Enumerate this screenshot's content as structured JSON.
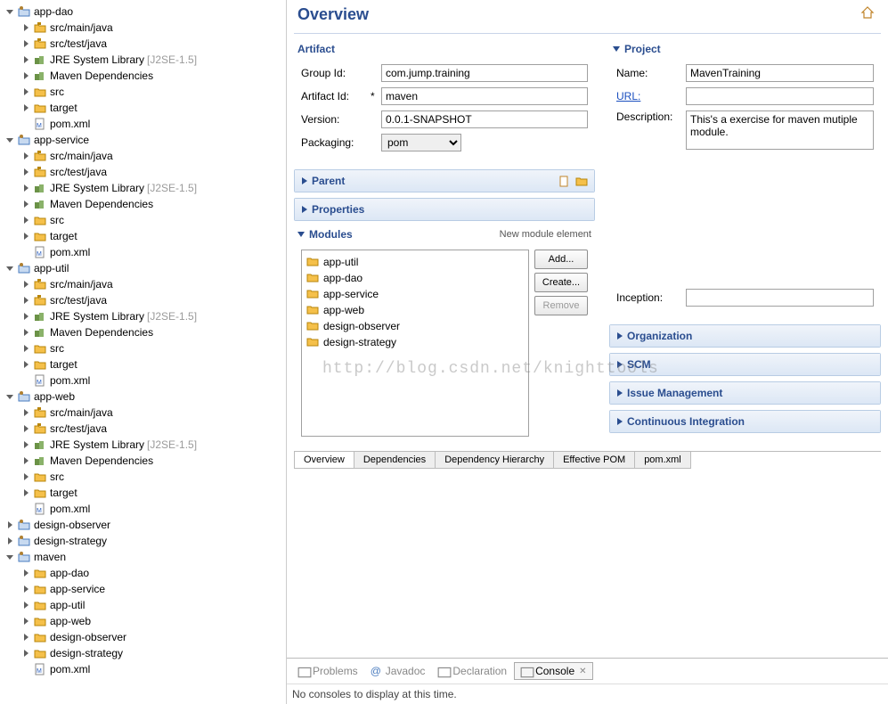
{
  "tree": {
    "projects": [
      {
        "name": "app-dao",
        "open": true,
        "type": "project",
        "children": [
          {
            "name": "src/main/java",
            "type": "pkg",
            "exp": "closed"
          },
          {
            "name": "src/test/java",
            "type": "pkg",
            "exp": "closed"
          },
          {
            "name": "JRE System Library",
            "suffix": "[J2SE-1.5]",
            "type": "jre",
            "exp": "closed"
          },
          {
            "name": "Maven Dependencies",
            "type": "mvn",
            "exp": "closed"
          },
          {
            "name": "src",
            "type": "fld",
            "exp": "closed"
          },
          {
            "name": "target",
            "type": "fld",
            "exp": "closed"
          },
          {
            "name": "pom.xml",
            "type": "xml",
            "exp": "none"
          }
        ]
      },
      {
        "name": "app-service",
        "open": true,
        "type": "project",
        "children": [
          {
            "name": "src/main/java",
            "type": "pkg",
            "exp": "closed"
          },
          {
            "name": "src/test/java",
            "type": "pkg",
            "exp": "closed"
          },
          {
            "name": "JRE System Library",
            "suffix": "[J2SE-1.5]",
            "type": "jre",
            "exp": "closed"
          },
          {
            "name": "Maven Dependencies",
            "type": "mvn",
            "exp": "closed"
          },
          {
            "name": "src",
            "type": "fld",
            "exp": "closed"
          },
          {
            "name": "target",
            "type": "fld",
            "exp": "closed"
          },
          {
            "name": "pom.xml",
            "type": "xml",
            "exp": "none"
          }
        ]
      },
      {
        "name": "app-util",
        "open": true,
        "type": "project",
        "children": [
          {
            "name": "src/main/java",
            "type": "pkg",
            "exp": "closed"
          },
          {
            "name": "src/test/java",
            "type": "pkg",
            "exp": "closed"
          },
          {
            "name": "JRE System Library",
            "suffix": "[J2SE-1.5]",
            "type": "jre",
            "exp": "closed"
          },
          {
            "name": "Maven Dependencies",
            "type": "mvn",
            "exp": "closed"
          },
          {
            "name": "src",
            "type": "fld",
            "exp": "closed"
          },
          {
            "name": "target",
            "type": "fld",
            "exp": "closed"
          },
          {
            "name": "pom.xml",
            "type": "xml",
            "exp": "none"
          }
        ]
      },
      {
        "name": "app-web",
        "open": true,
        "type": "project",
        "children": [
          {
            "name": "src/main/java",
            "type": "pkg",
            "exp": "closed"
          },
          {
            "name": "src/test/java",
            "type": "pkg",
            "exp": "closed"
          },
          {
            "name": "JRE System Library",
            "suffix": "[J2SE-1.5]",
            "type": "jre",
            "exp": "closed"
          },
          {
            "name": "Maven Dependencies",
            "type": "mvn",
            "exp": "closed"
          },
          {
            "name": "src",
            "type": "fld",
            "exp": "closed"
          },
          {
            "name": "target",
            "type": "fld",
            "exp": "closed"
          },
          {
            "name": "pom.xml",
            "type": "xml",
            "exp": "none"
          }
        ]
      },
      {
        "name": "design-observer",
        "open": false,
        "type": "project",
        "exp": "closed"
      },
      {
        "name": "design-strategy",
        "open": false,
        "type": "project",
        "exp": "closed"
      },
      {
        "name": "maven",
        "open": true,
        "type": "project",
        "children": [
          {
            "name": "app-dao",
            "type": "fld",
            "exp": "closed"
          },
          {
            "name": "app-service",
            "type": "fld",
            "exp": "closed"
          },
          {
            "name": "app-util",
            "type": "fld",
            "exp": "closed"
          },
          {
            "name": "app-web",
            "type": "fld",
            "exp": "closed"
          },
          {
            "name": "design-observer",
            "type": "fld",
            "exp": "closed"
          },
          {
            "name": "design-strategy",
            "type": "fld",
            "exp": "closed"
          },
          {
            "name": "pom.xml",
            "type": "xml",
            "exp": "none"
          }
        ]
      }
    ]
  },
  "overview": {
    "title": "Overview",
    "artifact": {
      "section": "Artifact",
      "groupIdLabel": "Group Id:",
      "groupId": "com.jump.training",
      "artifactIdLabel": "Artifact Id:",
      "artifactPre": "*",
      "artifactId": "maven",
      "versionLabel": "Version:",
      "version": "0.0.1-SNAPSHOT",
      "packagingLabel": "Packaging:",
      "packaging": "pom"
    },
    "parent": {
      "section": "Parent"
    },
    "properties": {
      "section": "Properties"
    },
    "modules": {
      "section": "Modules",
      "hint": "New module element",
      "items": [
        "app-util",
        "app-dao",
        "app-service",
        "app-web",
        "design-observer",
        "design-strategy"
      ],
      "addBtn": "Add...",
      "createBtn": "Create...",
      "removeBtn": "Remove"
    },
    "project": {
      "section": "Project",
      "nameLabel": "Name:",
      "name": "MavenTraining",
      "urlLabel": "URL:",
      "url": "",
      "descLabel": "Description:",
      "desc": "This's a exercise for maven mutiple module.",
      "inceptionLabel": "Inception:",
      "inception": ""
    },
    "organization": {
      "section": "Organization"
    },
    "scm": {
      "section": "SCM"
    },
    "issueMgmt": {
      "section": "Issue Management"
    },
    "ci": {
      "section": "Continuous Integration"
    }
  },
  "editorTabs": [
    "Overview",
    "Dependencies",
    "Dependency Hierarchy",
    "Effective POM",
    "pom.xml"
  ],
  "editorTabActive": 0,
  "viewTabs": [
    {
      "label": "Problems",
      "icon": "problems"
    },
    {
      "label": "Javadoc",
      "icon": "javadoc",
      "pre": "@"
    },
    {
      "label": "Declaration",
      "icon": "declaration"
    },
    {
      "label": "Console",
      "icon": "console",
      "active": true,
      "closable": true
    }
  ],
  "consoleMsg": "No consoles to display at this time.",
  "watermark": "http://blog.csdn.net/knighttools"
}
